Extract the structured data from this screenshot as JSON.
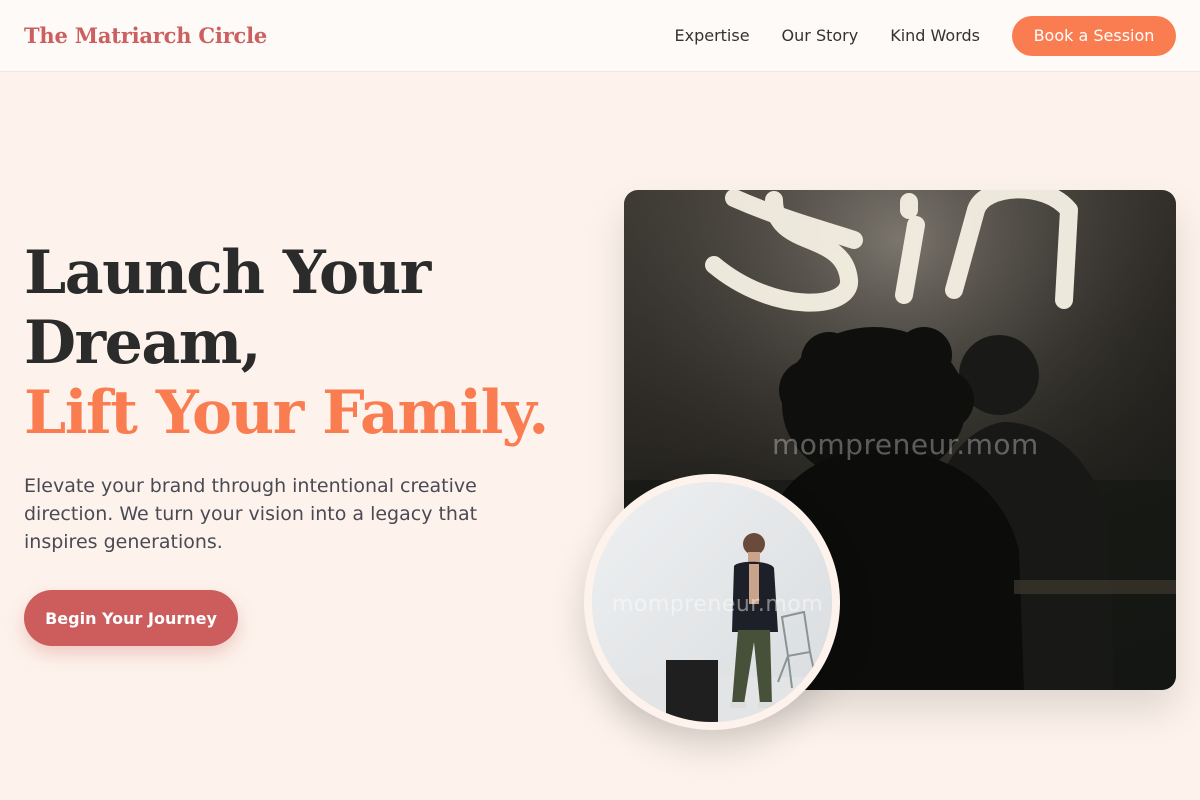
{
  "header": {
    "brand": "The Matriarch Circle",
    "nav": [
      "Expertise",
      "Our Story",
      "Kind Words"
    ],
    "cta": "Book a Session"
  },
  "hero": {
    "headline_line1": "Launch Your",
    "headline_line2": "Dream,",
    "headline_accent": "Lift Your Family.",
    "subtext": "Elevate your brand through intentional creative direction. We turn your vision into a legacy that inspires generations.",
    "cta": "Begin Your Journey"
  },
  "images": {
    "main_watermark": "mompreneur.mom",
    "round_watermark": "mompreneur.mom"
  },
  "colors": {
    "brand": "#cc6060",
    "accent": "#fa7d52",
    "primary_button": "#cd5c5c",
    "background": "#fdf3ec"
  }
}
